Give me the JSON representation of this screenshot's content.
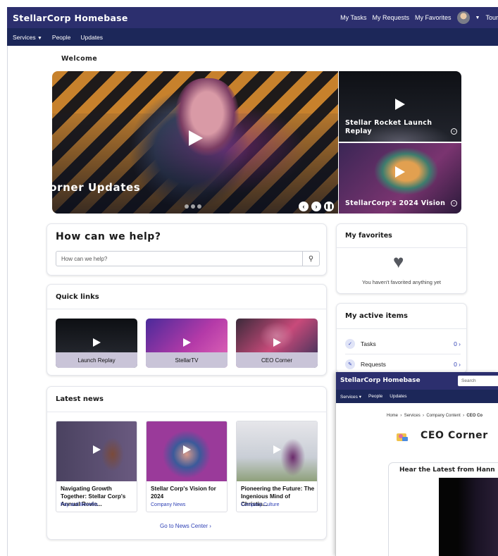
{
  "header": {
    "brand": "StellarCorp Homebase",
    "nav": [
      "My Tasks",
      "My Requests",
      "My Favorites"
    ],
    "user_menu_trunc": "Tour"
  },
  "subnav": {
    "items": [
      "Services",
      "People",
      "Updates"
    ]
  },
  "welcome": "Welcome",
  "carousel": {
    "main_title": "CEO Corner Updates",
    "side_titles": [
      "Stellar Rocket Launch Replay",
      "StellarCorp's 2024 Vision"
    ],
    "dots": 3
  },
  "help": {
    "title": "How can we help?",
    "placeholder": "How can we help?"
  },
  "quick_links": {
    "title": "Quick links",
    "items": [
      "Launch Replay",
      "StellarTV",
      "CEO Corner"
    ]
  },
  "latest_news": {
    "title": "Latest news",
    "items": [
      {
        "title": "Navigating Growth Together: Stellar Corp's Annual Revie...",
        "category": "Pay and Benefits"
      },
      {
        "title": "Stellar Corp's Vision for 2024",
        "category": "Company News"
      },
      {
        "title": "Pioneering the Future: The Ingenious Mind of Christin...",
        "category": "Company Culture"
      }
    ],
    "link": "Go to News Center"
  },
  "favorites": {
    "title": "My favorites",
    "empty_text": "You haven't favorited anything yet"
  },
  "active_items": {
    "title": "My active items",
    "rows": [
      {
        "label": "Tasks",
        "count": "0"
      },
      {
        "label": "Requests",
        "count": "0"
      }
    ]
  },
  "popup": {
    "brand": "StellarCorp Homebase",
    "search_placeholder": "Search",
    "subnav": [
      "Services",
      "People",
      "Updates"
    ],
    "breadcrumb": [
      "Home",
      "Services",
      "Company Content",
      "CEO Co"
    ],
    "title": "CEO Corner",
    "section_heading": "Hear the Latest from Hann"
  },
  "colors": {
    "topbar": "#2c2f6e",
    "subnav": "#1c2759",
    "link": "#2f41b5"
  }
}
